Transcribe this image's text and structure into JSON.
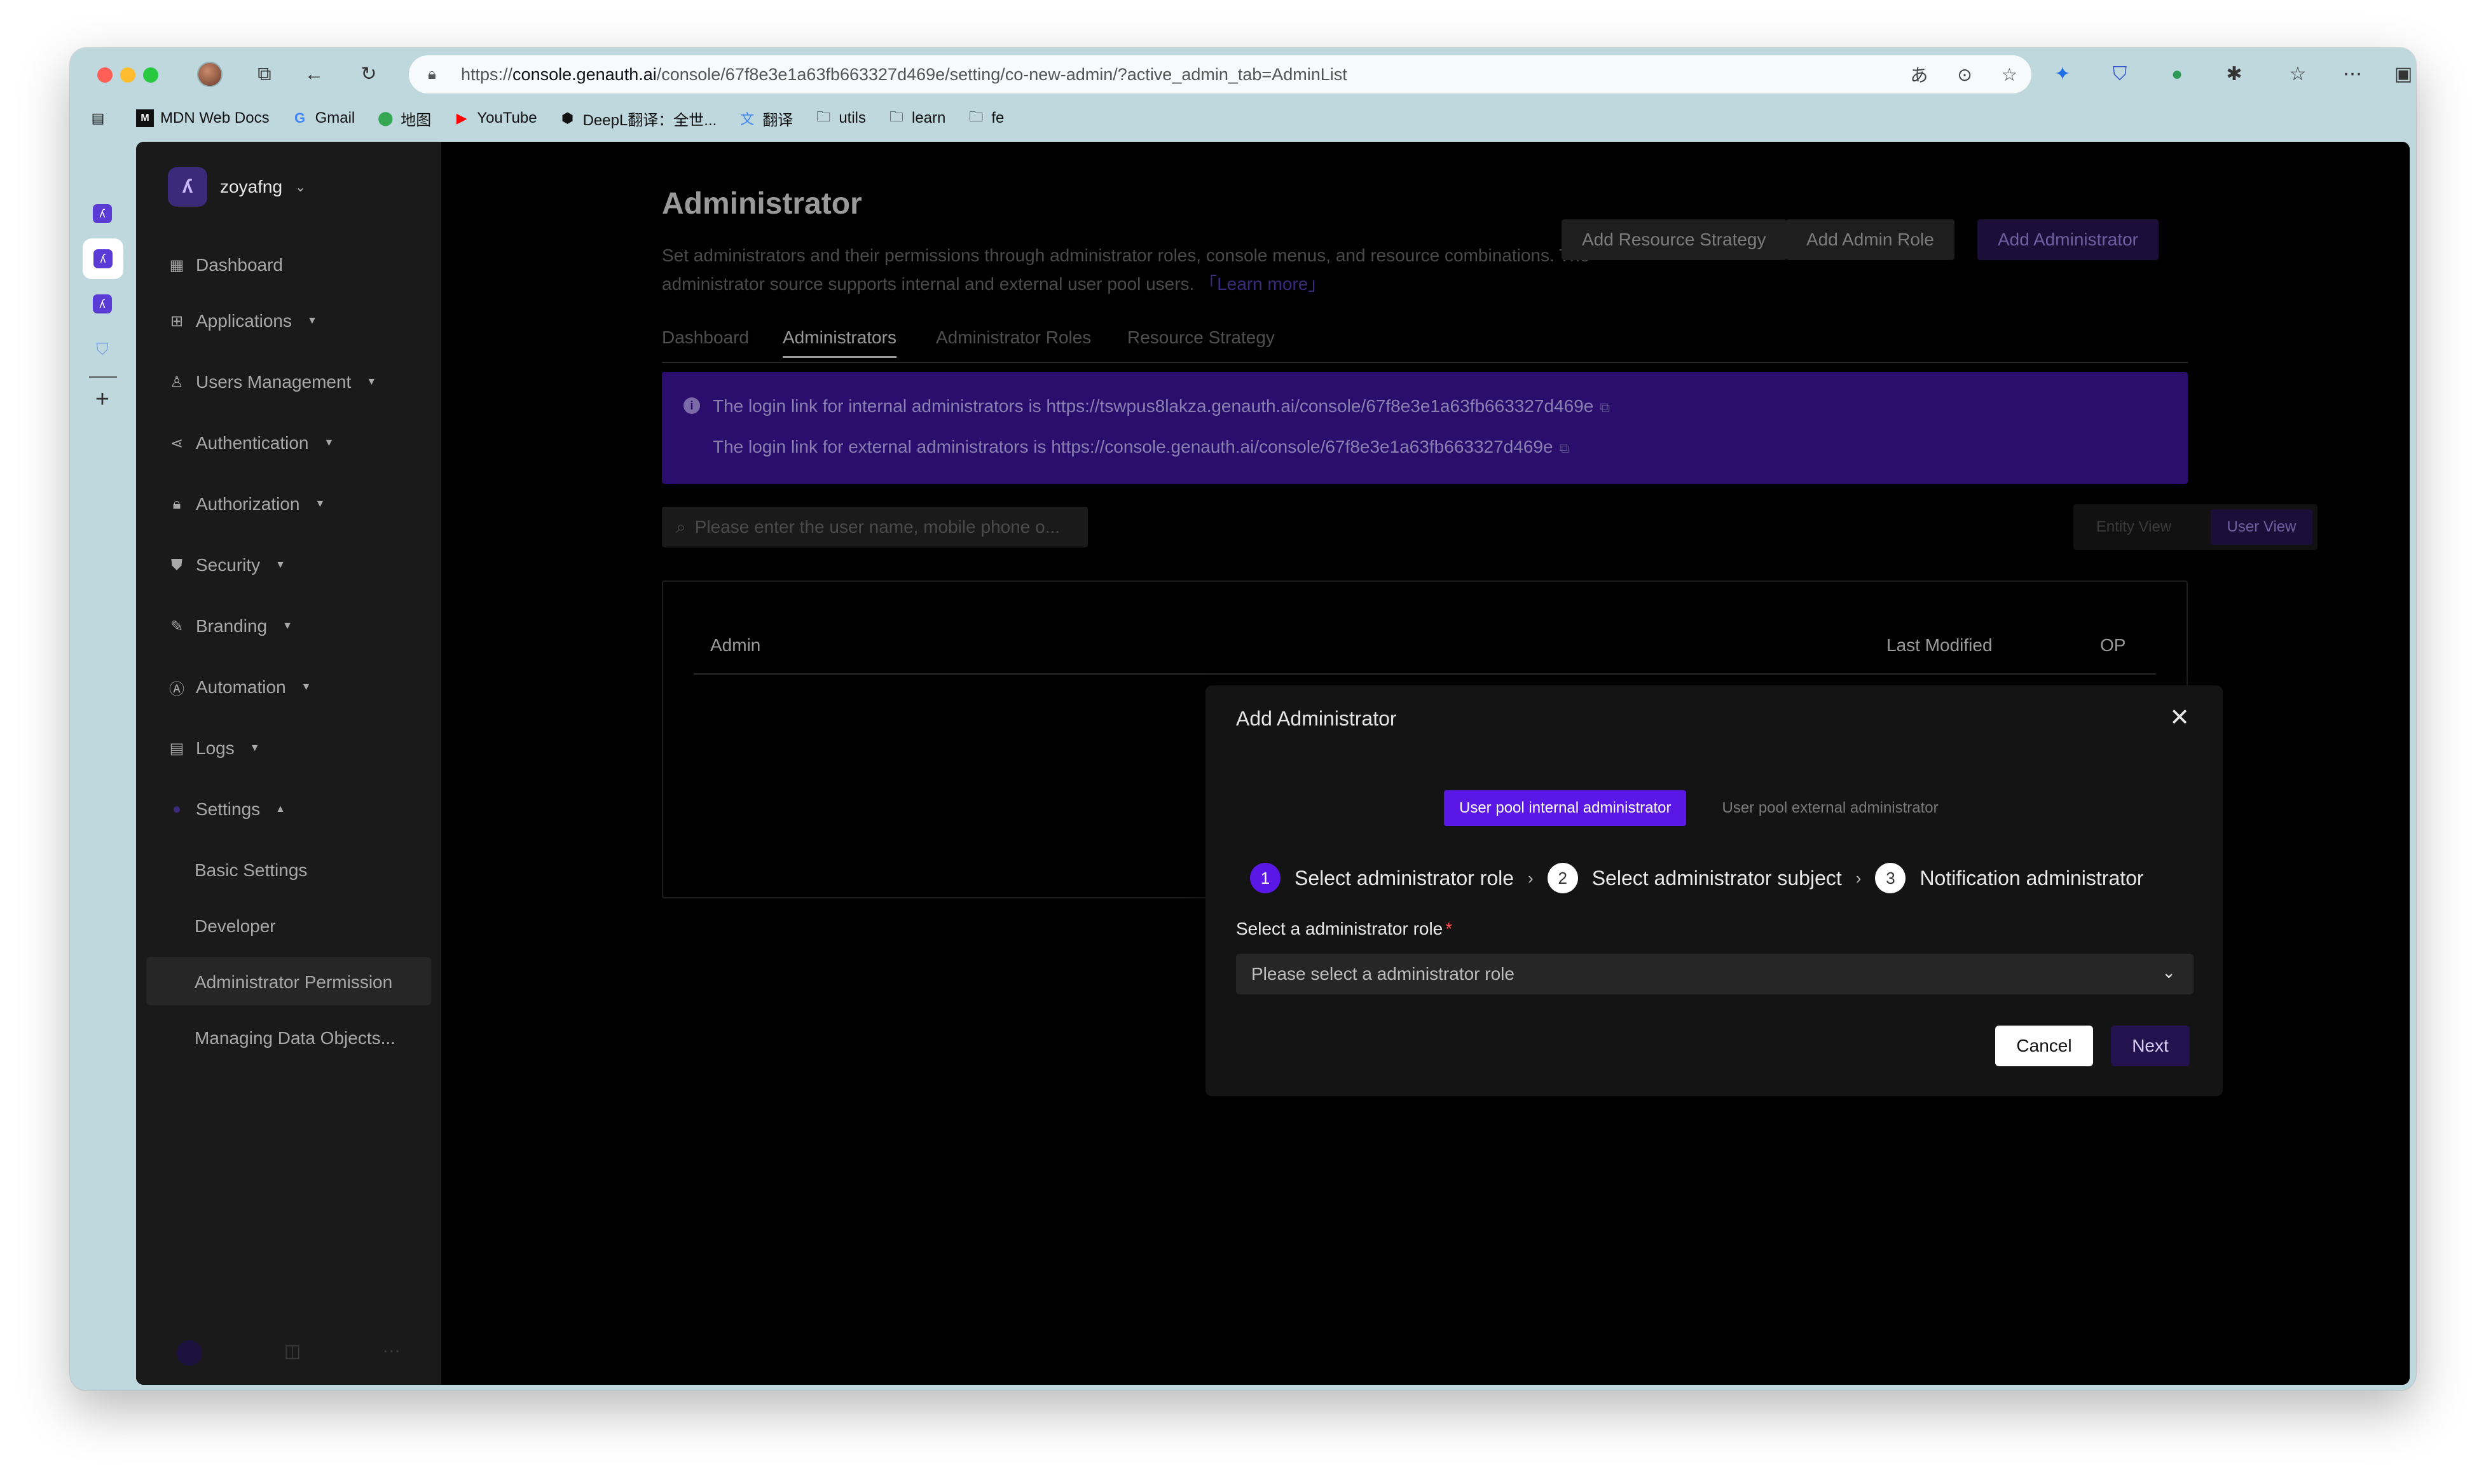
{
  "browser": {
    "url_prefix": "https://",
    "url_host": "console.genauth.ai",
    "url_path": "/console/67f8e3e1a63fb663327d469e/setting/co-new-admin/?active_admin_tab=AdminList",
    "bookmarks": [
      {
        "label": "MDN Web Docs",
        "icon": "mdn-icon"
      },
      {
        "label": "Gmail",
        "icon": "google-icon"
      },
      {
        "label": "地图",
        "icon": "maps-icon"
      },
      {
        "label": "YouTube",
        "icon": "youtube-icon"
      },
      {
        "label": "DeepL翻译：全世...",
        "icon": "deepl-icon"
      },
      {
        "label": "翻译",
        "icon": "translate-icon"
      },
      {
        "label": "utils",
        "icon": "folder-icon"
      },
      {
        "label": "learn",
        "icon": "folder-icon"
      },
      {
        "label": "fe",
        "icon": "folder-icon"
      }
    ]
  },
  "sidebar": {
    "org_name": "zoyafng",
    "items": [
      {
        "label": "Dashboard",
        "icon": "grid-icon"
      },
      {
        "label": "Applications",
        "icon": "apps-icon"
      },
      {
        "label": "Users Management",
        "icon": "user-icon"
      },
      {
        "label": "Authentication",
        "icon": "share-icon"
      },
      {
        "label": "Authorization",
        "icon": "lock-icon"
      },
      {
        "label": "Security",
        "icon": "shield-icon"
      },
      {
        "label": "Branding",
        "icon": "brush-icon"
      },
      {
        "label": "Automation",
        "icon": "automation-icon"
      },
      {
        "label": "Logs",
        "icon": "logs-icon"
      },
      {
        "label": "Settings",
        "icon": "settings-icon"
      }
    ],
    "settings_sub": [
      {
        "label": "Basic Settings"
      },
      {
        "label": "Developer"
      },
      {
        "label": "Administrator Permission"
      },
      {
        "label": "Managing Data Objects..."
      }
    ]
  },
  "main": {
    "title": "Administrator",
    "description": "Set administrators and their permissions through administrator roles, console menus, and resource combinations. The administrator source supports internal and external user pool users.",
    "learn_more": "「Learn more」",
    "buttons": {
      "add_resource_strategy": "Add Resource Strategy",
      "add_admin_role": "Add Admin Role",
      "add_administrator": "Add Administrator"
    },
    "tabs": [
      "Dashboard",
      "Administrators",
      "Administrator Roles",
      "Resource Strategy"
    ],
    "banner": {
      "internal": "The login link for internal administrators is https://tswpus8lakza.genauth.ai/console/67f8e3e1a63fb663327d469e",
      "external": "The login link for external administrators is https://console.genauth.ai/console/67f8e3e1a63fb663327d469e"
    },
    "search_placeholder": "Please enter the user name, mobile phone o...",
    "views": {
      "entity": "Entity View",
      "user": "User View"
    },
    "table_headers": {
      "admin": "Admin",
      "last_modified": "Last Modified",
      "op": "OP"
    }
  },
  "modal": {
    "title": "Add Administrator",
    "pool_tabs": [
      "User pool internal administrator",
      "User pool external administrator"
    ],
    "steps": [
      {
        "num": "1",
        "label": "Select administrator role"
      },
      {
        "num": "2",
        "label": "Select administrator subject"
      },
      {
        "num": "3",
        "label": "Notification administrator"
      }
    ],
    "field_label": "Select a administrator role",
    "required_mark": "*",
    "select_placeholder": "Please select a administrator role",
    "cancel": "Cancel",
    "next": "Next"
  },
  "colors": {
    "accent": "#5b17e6",
    "banner_bg": "#2a0e6e",
    "overlay_bg": "#000000",
    "browser_chrome": "#bfd8de"
  }
}
